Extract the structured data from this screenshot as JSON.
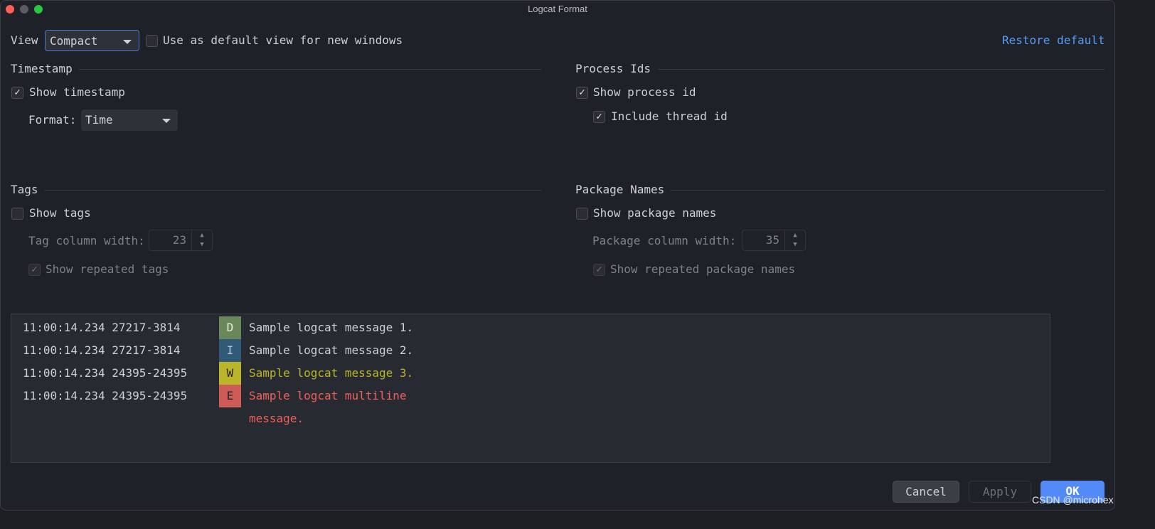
{
  "window": {
    "title": "Logcat Format"
  },
  "view": {
    "label": "View",
    "selected": "Compact",
    "default_checkbox_label": "Use as default view for new windows",
    "default_checked": false,
    "restore_label": "Restore default"
  },
  "timestamp": {
    "title": "Timestamp",
    "show_label": "Show timestamp",
    "show_checked": true,
    "format_label": "Format:",
    "format_value": "Time"
  },
  "process_ids": {
    "title": "Process Ids",
    "show_label": "Show process id",
    "show_checked": true,
    "thread_label": "Include thread id",
    "thread_checked": true
  },
  "tags": {
    "title": "Tags",
    "show_label": "Show tags",
    "show_checked": false,
    "width_label": "Tag column width:",
    "width_value": "23",
    "repeated_label": "Show repeated tags",
    "repeated_checked": true
  },
  "package_names": {
    "title": "Package Names",
    "show_label": "Show package names",
    "show_checked": false,
    "width_label": "Package column width:",
    "width_value": "35",
    "repeated_label": "Show repeated package names",
    "repeated_checked": true
  },
  "preview": [
    {
      "time": "11:00:14.234",
      "pid": "27217-3814",
      "level": "D",
      "message": "Sample logcat message 1.",
      "level_bg": "#6a8759",
      "level_fg": "#e8f0e0",
      "msg_color": "#cdd0d6"
    },
    {
      "time": "11:00:14.234",
      "pid": "27217-3814",
      "level": "I",
      "message": "Sample logcat message 2.",
      "level_bg": "#305a78",
      "level_fg": "#b8c4ce",
      "msg_color": "#cdd0d6"
    },
    {
      "time": "11:00:14.234",
      "pid": "24395-24395",
      "level": "W",
      "message": "Sample logcat message 3.",
      "level_bg": "#bbb529",
      "level_fg": "#1f2128",
      "msg_color": "#bbb529"
    },
    {
      "time": "11:00:14.234",
      "pid": "24395-24395",
      "level": "E",
      "message": "Sample logcat multiline",
      "message_cont": "message.",
      "level_bg": "#cf5b56",
      "level_fg": "#1f2128",
      "msg_color": "#f0605a"
    }
  ],
  "buttons": {
    "cancel": "Cancel",
    "apply": "Apply",
    "ok": "OK"
  },
  "watermark": "CSDN @microhex",
  "colors": {
    "accent": "#548af7",
    "link": "#589df6"
  }
}
